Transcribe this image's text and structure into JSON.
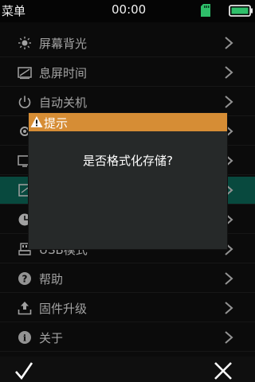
{
  "status_bar": {
    "title": "菜单",
    "time": "00:00"
  },
  "menu": {
    "items": [
      {
        "label": "屏幕背光",
        "icon": "brightness-icon"
      },
      {
        "label": "息屏时间",
        "icon": "screen-timeout-icon"
      },
      {
        "label": "自动关机",
        "icon": "power-icon"
      },
      {
        "label": "",
        "icon": "settings-icon"
      },
      {
        "label": "",
        "icon": "display-icon"
      },
      {
        "label": "",
        "icon": "storage-icon"
      },
      {
        "label": "",
        "icon": "clock-icon"
      },
      {
        "label": "USB模式",
        "icon": "usb-icon"
      },
      {
        "label": "帮助",
        "icon": "help-icon"
      },
      {
        "label": "固件升级",
        "icon": "upgrade-icon"
      },
      {
        "label": "关于",
        "icon": "info-icon"
      }
    ]
  },
  "dialog": {
    "title": "提示",
    "message": "是否格式化存储?"
  },
  "colors": {
    "dialog_header": "#d68d35",
    "dialog_body": "#262929",
    "active_item": "#0b5e50",
    "battery": "#2fbf6a",
    "sd_card": "#2fbf6a"
  }
}
